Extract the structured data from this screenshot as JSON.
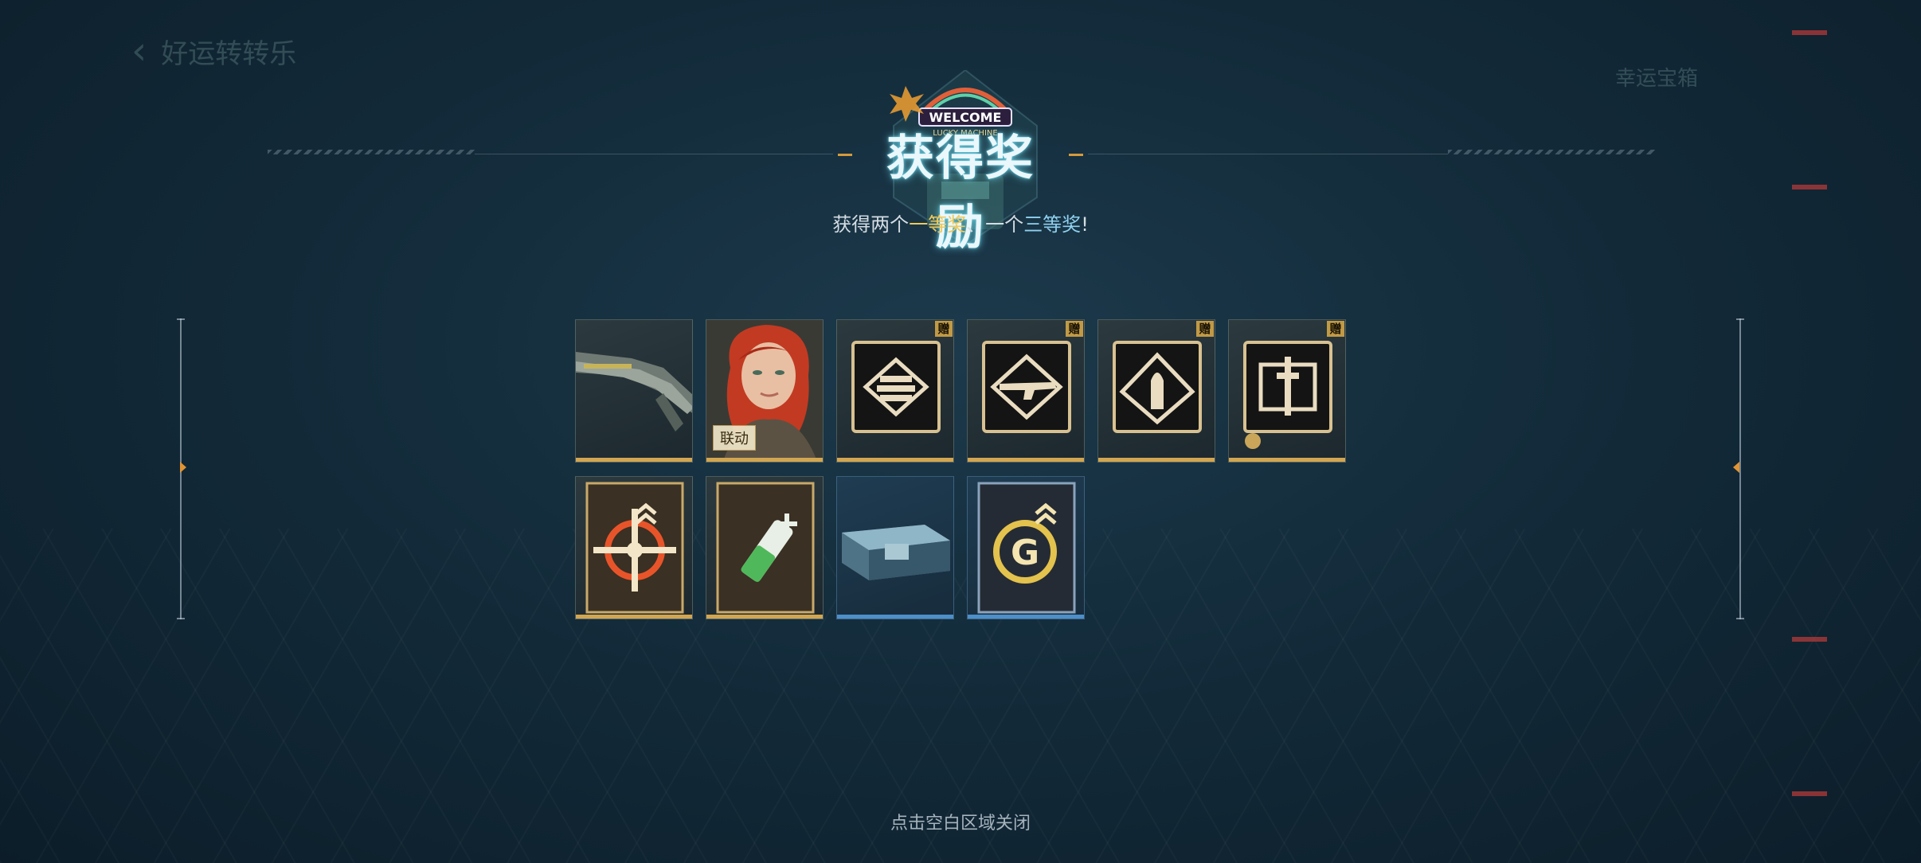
{
  "background": {
    "back_label": "好运转转乐",
    "right_label": "幸运宝箱"
  },
  "header": {
    "title": "获得奖励",
    "logo_text_1": "WELCOME",
    "logo_text_2": "LUCKY MACHINE",
    "subtitle_prefix": "获得两个",
    "subtitle_first_prize": "一等奖",
    "subtitle_sep": "、一个",
    "subtitle_third_prize": "三等奖",
    "subtitle_suffix": "!"
  },
  "rewards": [
    {
      "name": "rifle-weapon",
      "rarity": "gold",
      "gift": false
    },
    {
      "name": "red-hair-character",
      "rarity": "gold",
      "gift": false,
      "tag": "联动"
    },
    {
      "name": "ammo-emblem",
      "rarity": "gold",
      "gift": true,
      "gift_label": "赠"
    },
    {
      "name": "assault-rifle-emblem",
      "rarity": "gold",
      "gift": true,
      "gift_label": "赠"
    },
    {
      "name": "bullet-emblem",
      "rarity": "gold",
      "gift": true,
      "gift_label": "赠"
    },
    {
      "name": "syringe-emblem",
      "rarity": "gold",
      "gift": true,
      "gift_label": "赠"
    },
    {
      "name": "crosshair-upgrade",
      "rarity": "gold",
      "gift": false
    },
    {
      "name": "stim-upgrade",
      "rarity": "gold",
      "gift": false
    },
    {
      "name": "supply-crate",
      "rarity": "blue",
      "gift": false
    },
    {
      "name": "g-coin-upgrade",
      "rarity": "blue",
      "gift": false
    }
  ],
  "colors": {
    "gold": "#d2a651",
    "blue": "#4d8fc8",
    "accent_orange": "#e29433",
    "title_glow": "#4fd0e6"
  },
  "footer": {
    "close_hint": "点击空白区域关闭"
  }
}
